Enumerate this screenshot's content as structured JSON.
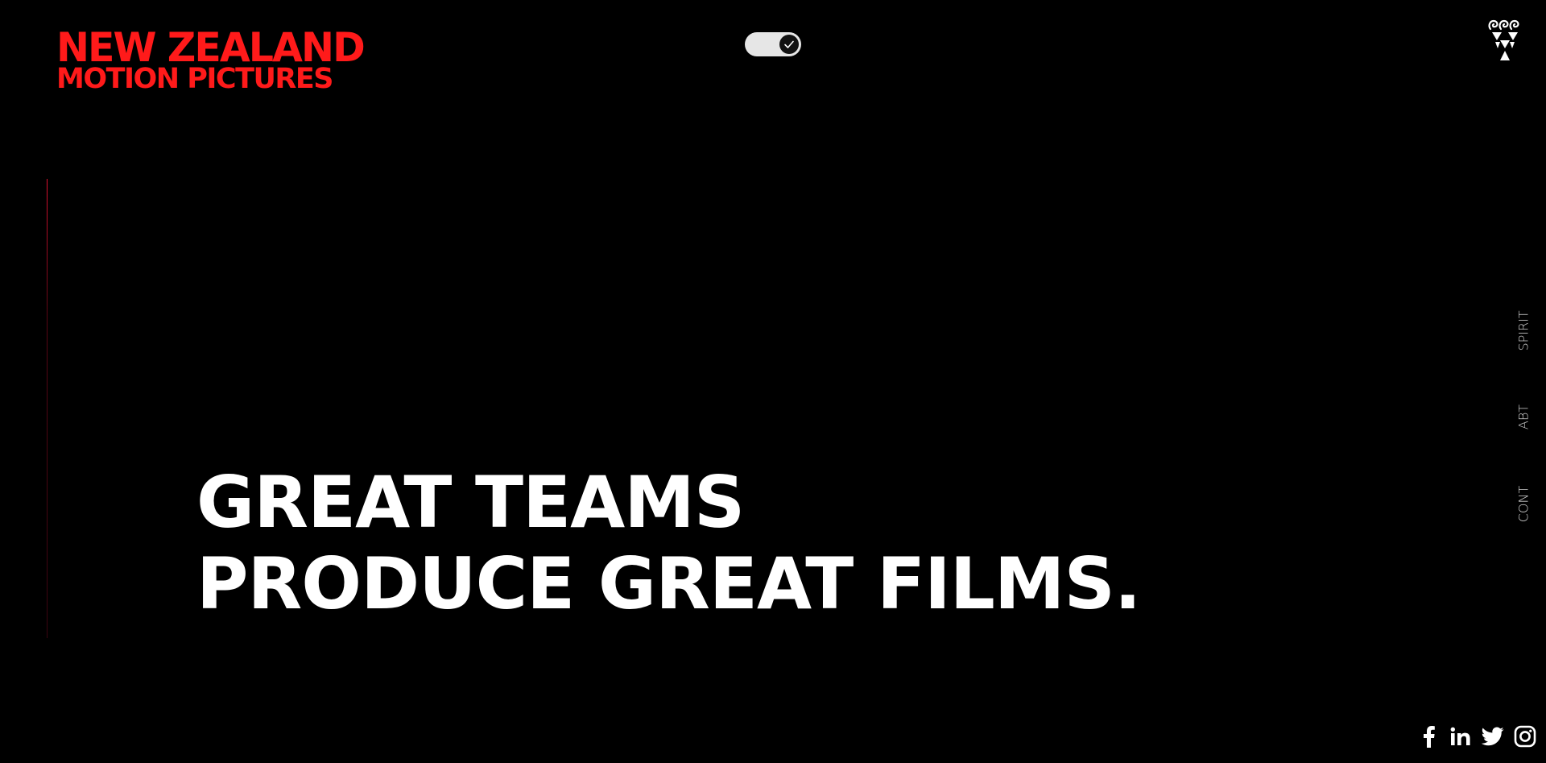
{
  "logo": {
    "line1": "NEW ZEALAND",
    "line2": "MOTION PICTURES"
  },
  "toggle": {
    "state": "on",
    "icon": "check-icon"
  },
  "brand_mark": {
    "icon": "triangle-spiral-emblem-icon"
  },
  "hero": {
    "line1": "GREAT TEAMS",
    "line2": "PRODUCE GREAT FILMS."
  },
  "side_nav": {
    "items": [
      {
        "label": "SPIRIT"
      },
      {
        "label": "ABT"
      },
      {
        "label": "CONT"
      }
    ]
  },
  "socials": [
    {
      "icon": "facebook-icon"
    },
    {
      "icon": "linkedin-icon"
    },
    {
      "icon": "twitter-icon"
    },
    {
      "icon": "instagram-icon"
    }
  ],
  "colors": {
    "background": "#000000",
    "brand_red": "#ff1a1a",
    "text": "#ffffff",
    "rule": "#e01030"
  }
}
